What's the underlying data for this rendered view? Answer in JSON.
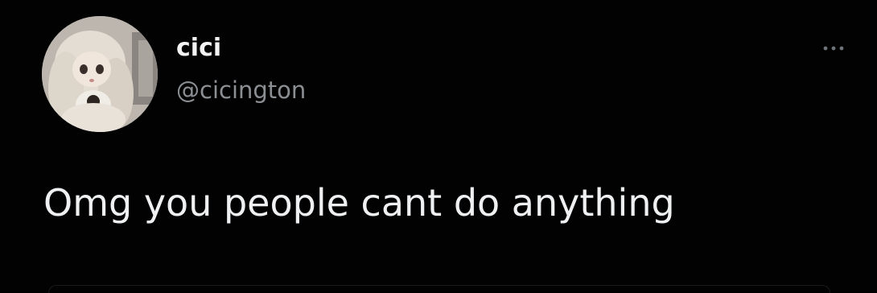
{
  "tweet": {
    "author": {
      "display_name": "cici",
      "handle": "@cicington",
      "avatar_icon": "doll-avatar"
    },
    "text": "Omg you people cant do anything",
    "more_icon": "more-options-icon"
  },
  "colors": {
    "background": "#020202",
    "primary_text": "#eef0f1",
    "secondary_text": "#8b8f94"
  }
}
